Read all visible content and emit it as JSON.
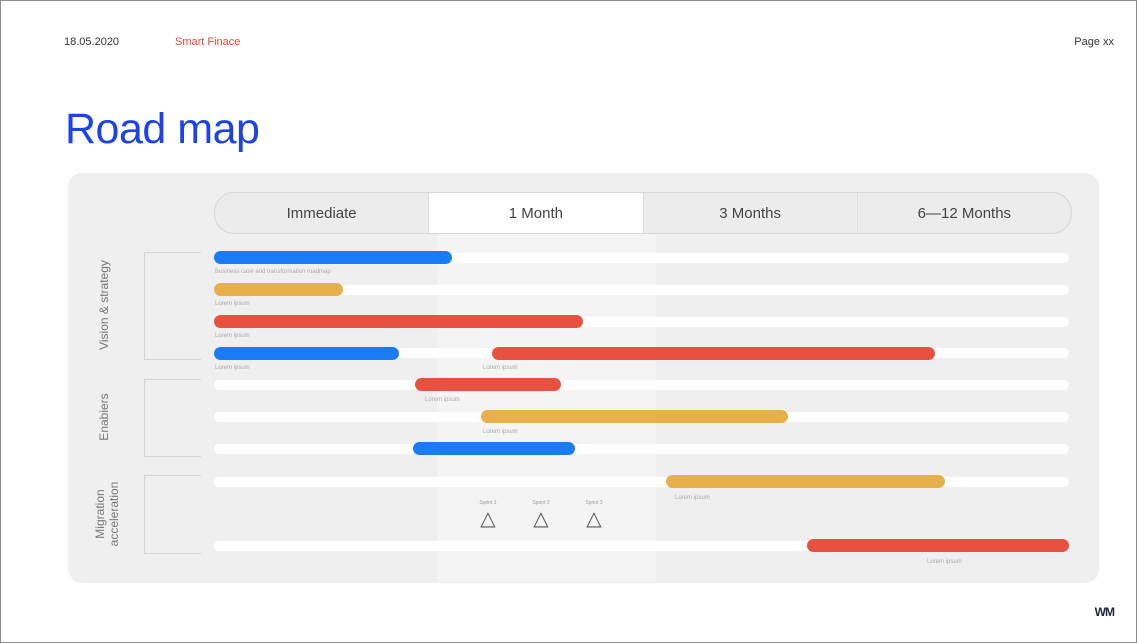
{
  "header": {
    "date": "18.05.2020",
    "brand": "Smart Finace",
    "page": "Page xx"
  },
  "title": "Road map",
  "timeline": {
    "columns": [
      "Immediate",
      "1 Month",
      "3 Months",
      "6—12 Months"
    ],
    "active_index": 1
  },
  "groups": [
    {
      "label": "Vision & strategy"
    },
    {
      "label": "Enabiers"
    },
    {
      "label": "Migration acceleration"
    }
  ],
  "bar_labels": {
    "b1": "Business case and transformation roadmap",
    "b2": "Lorem ipsum",
    "b3": "Lorem ipsum",
    "b4": "Lorem ipsum",
    "b5": "Lorem ipsum",
    "b6": "Lorem ipsum",
    "b7": "Lorem ipsum",
    "b8": "Lorem ipsum",
    "b9": "Lorem ipsum"
  },
  "sprints": [
    "Sprint 1",
    "Sprint 2",
    "Sprint 3"
  ],
  "colors": {
    "blue": "#1a7cf5",
    "orange": "#e8b04a",
    "red": "#e8513f",
    "title": "#1d43e6",
    "brand": "#e8473c"
  },
  "logo": "WM"
}
